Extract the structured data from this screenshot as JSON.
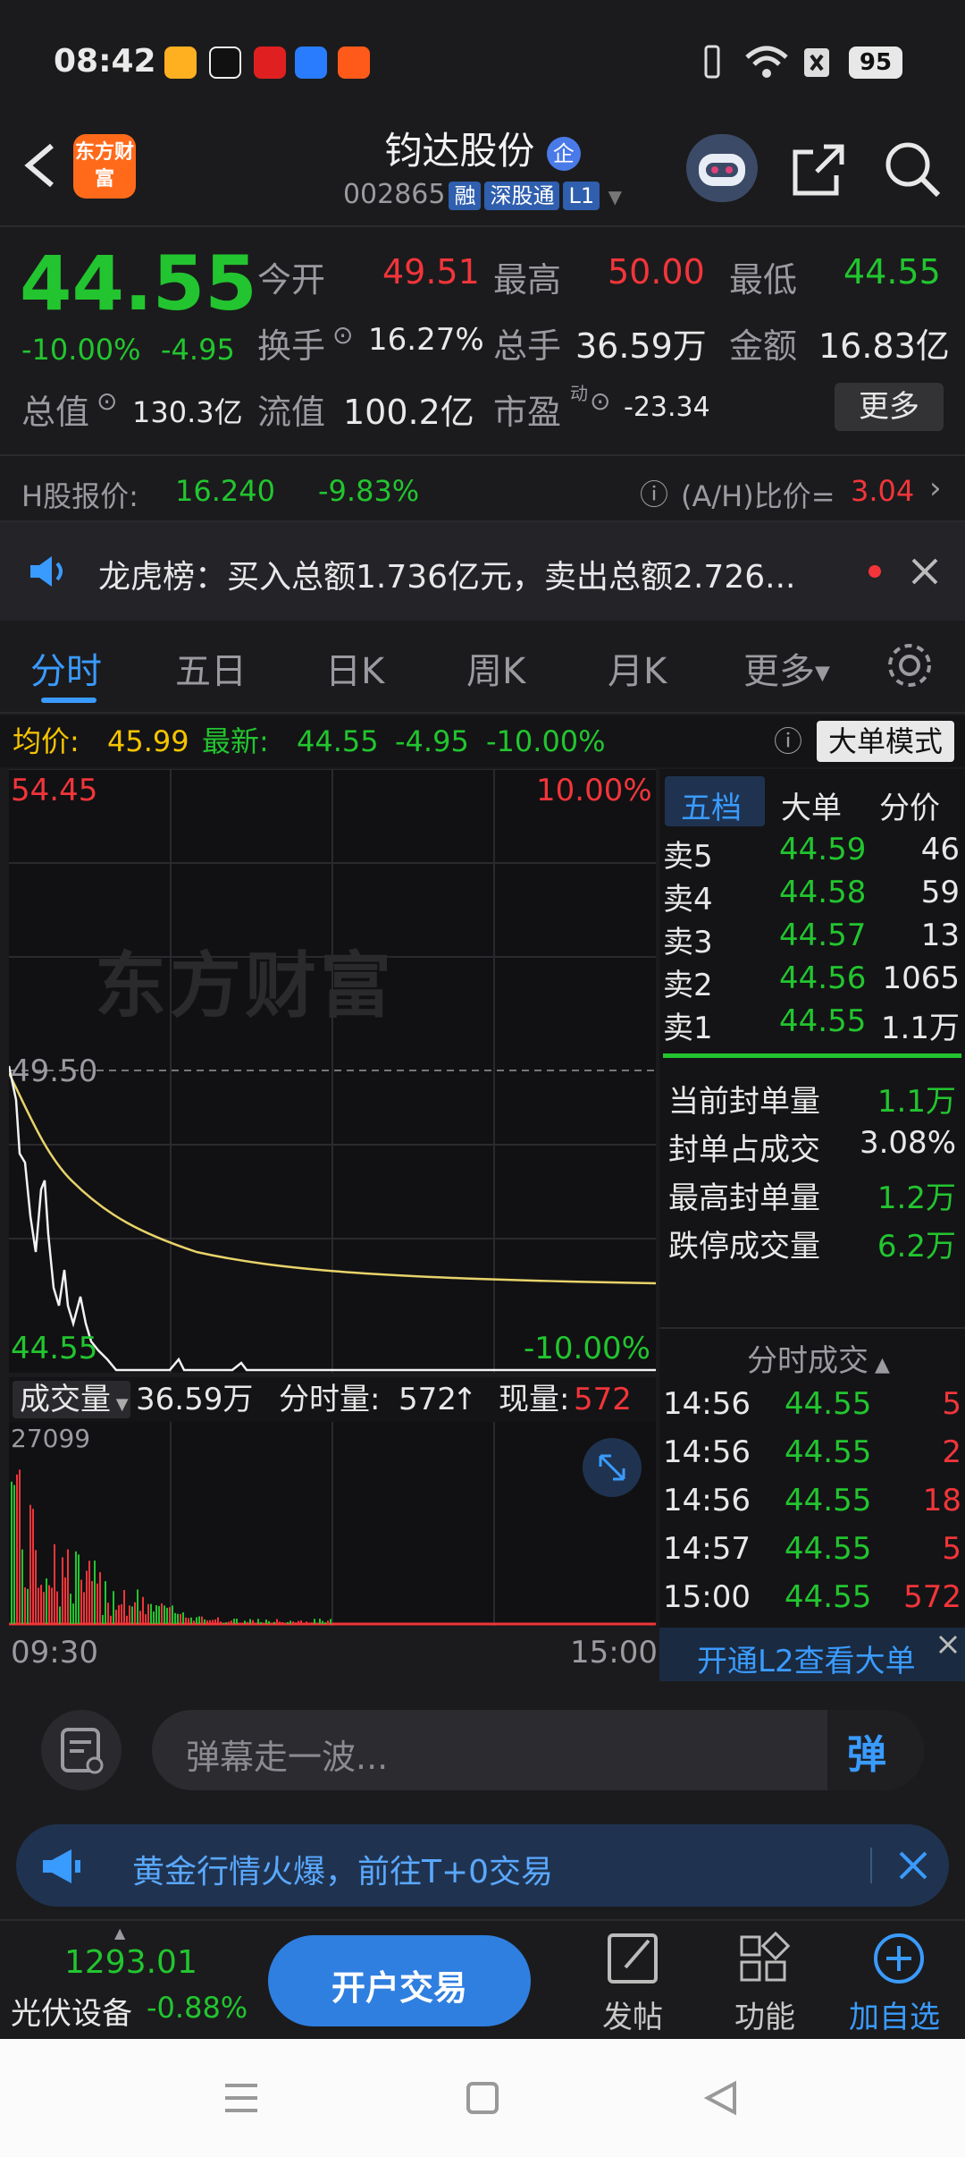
{
  "status": {
    "time": "08:42",
    "battery": "95"
  },
  "header": {
    "logo_text": "东方财富",
    "name": "钧达股份",
    "name_badge": "企",
    "code": "002865",
    "tags": [
      "融",
      "深股通",
      "L1"
    ]
  },
  "quote": {
    "price": "44.55",
    "change_pct": "-10.00%",
    "change": "-4.95",
    "open_label": "今开",
    "open": "49.51",
    "high_label": "最高",
    "high": "50.00",
    "low_label": "最低",
    "low": "44.55",
    "turnover_label": "换手",
    "turnover": "16.27%",
    "volume_label": "总手",
    "volume": "36.59万",
    "amount_label": "金额",
    "amount": "16.83亿",
    "mktcap_label": "总值",
    "mktcap": "130.3亿",
    "float_label": "流值",
    "float": "100.2亿",
    "pe_label": "市盈",
    "pe_sup": "动",
    "pe": "-23.34",
    "more": "更多"
  },
  "hshare": {
    "label": "H股报价:",
    "price": "16.240",
    "pct": "-9.83%",
    "ah_label": "(A/H)比价=",
    "ah": "3.04"
  },
  "lhb": {
    "text": "龙虎榜：买入总额1.736亿元，卖出总额2.726..."
  },
  "tabs": [
    "分时",
    "五日",
    "日K",
    "周K",
    "月K",
    "更多"
  ],
  "avg": {
    "avg_label": "均价:",
    "avg": "45.99",
    "latest_label": "最新:",
    "latest": "44.55",
    "chg": "-4.95",
    "pct": "-10.00%",
    "mode": "大单模式"
  },
  "chart": {
    "top_price": "54.45",
    "top_pct": "10.00%",
    "mid_price": "49.50",
    "bottom_price": "44.55",
    "bottom_pct": "-10.00%",
    "watermark": "东方财富"
  },
  "orderbook": {
    "tabs": [
      "五档",
      "大单",
      "分价"
    ],
    "asks": [
      {
        "label": "卖5",
        "price": "44.59",
        "vol": "46"
      },
      {
        "label": "卖4",
        "price": "44.58",
        "vol": "59"
      },
      {
        "label": "卖3",
        "price": "44.57",
        "vol": "13"
      },
      {
        "label": "卖2",
        "price": "44.56",
        "vol": "1065"
      },
      {
        "label": "卖1",
        "price": "44.55",
        "vol": "1.1万"
      }
    ],
    "stats": [
      {
        "label": "当前封单量",
        "value": "1.1万"
      },
      {
        "label": "封单占成交",
        "value": "3.08%"
      },
      {
        "label": "最高封单量",
        "value": "1.2万"
      },
      {
        "label": "跌停成交量",
        "value": "6.2万"
      }
    ],
    "ticks_title": "分时成交",
    "ticks": [
      {
        "time": "14:56",
        "price": "44.55",
        "vol": "5"
      },
      {
        "time": "14:56",
        "price": "44.55",
        "vol": "2"
      },
      {
        "time": "14:56",
        "price": "44.55",
        "vol": "18"
      },
      {
        "time": "14:57",
        "price": "44.55",
        "vol": "5"
      },
      {
        "time": "15:00",
        "price": "44.55",
        "vol": "572"
      }
    ],
    "l2": "开通L2查看大单"
  },
  "volume": {
    "label": "成交量",
    "total": "36.59万",
    "period_label": "分时量:",
    "period": "572",
    "now_label": "现量:",
    "now": "572",
    "max": "27099"
  },
  "time_axis": {
    "start": "09:30",
    "end": "15:00"
  },
  "danmu": {
    "placeholder": "弹幕走一波...",
    "send": "弹"
  },
  "promo": {
    "text": "黄金行情火爆，前往T+0交易"
  },
  "bottom": {
    "index_value": "1293.01",
    "index_name": "光伏设备",
    "index_pct": "-0.88%",
    "trade": "开户交易",
    "post": "发帖",
    "func": "功能",
    "add": "加自选"
  }
}
